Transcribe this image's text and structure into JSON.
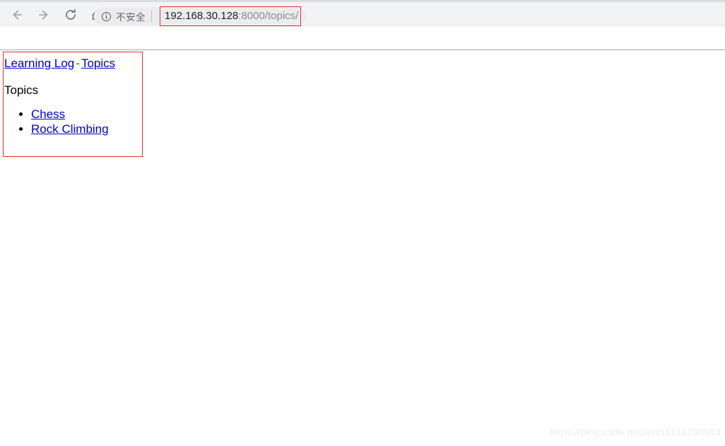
{
  "browser": {
    "nav": {
      "back_label": "Back",
      "forward_label": "Forward",
      "reload_label": "Reload",
      "home_label": "Home"
    },
    "omnibox": {
      "security_icon": "info-circle-icon",
      "security_text": "不安全",
      "url_host": "192.168.30.128",
      "url_path": ":8000/topics/",
      "full_url": "192.168.30.128:8000/topics/"
    },
    "annotation_color": "#e02f2f"
  },
  "page": {
    "breadcrumb": {
      "home_link": "Learning Log",
      "separator": "-",
      "current_link": "Topics"
    },
    "heading": "Topics",
    "topics": [
      {
        "label": "Chess"
      },
      {
        "label": "Rock Climbing"
      }
    ]
  },
  "watermark": {
    "text": "https://blog.csdn.net/miss1181248983"
  }
}
